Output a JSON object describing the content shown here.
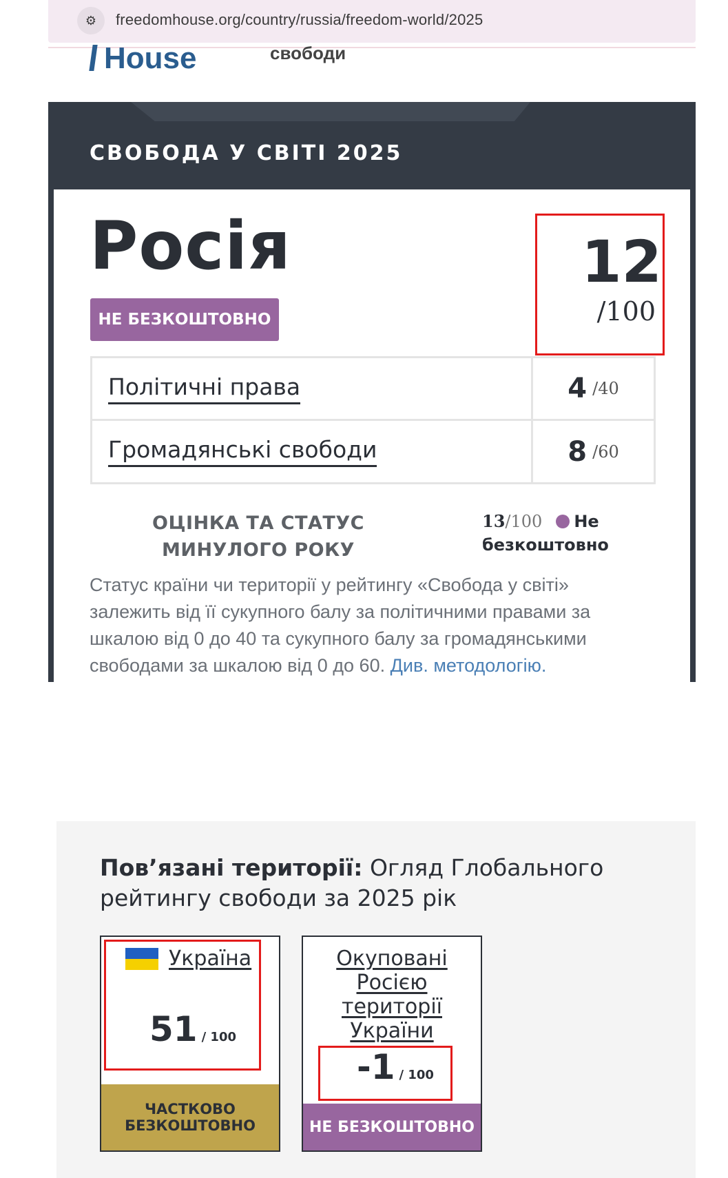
{
  "browser": {
    "url": "freedomhouse.org/country/russia/freedom-world/2025",
    "site_icon": "tune-icon"
  },
  "header": {
    "logo_text": "House",
    "fragment_text": "свободи"
  },
  "report": {
    "section_title": "СВОБОДА У СВІТІ 2025",
    "country": "Росія",
    "status": "НЕ БЕЗКОШТОВНО",
    "total_score": "12",
    "total_out_of": "/100",
    "subscores": [
      {
        "label": "Політичні права",
        "score": "4",
        "out_of": "/40"
      },
      {
        "label": "Громадянські свободи",
        "score": "8",
        "out_of": "/60"
      }
    ],
    "previous": {
      "label": "ОЦІНКА ТА СТАТУС МИНУЛОГО РОКУ",
      "score": "13",
      "out_of": "/100",
      "status": "Не безкоштовно"
    },
    "methodology_text": "Статус країни чи території у рейтингу «Свобода у світі» залежить від її сукупного балу за політичними правами за шкалою від 0 до 40 та сукупного балу за громадянськими свободами за шкалою від 0 до 60.",
    "methodology_link": "Див. методологію."
  },
  "related": {
    "title_bold": "Пов’язані території:",
    "title_rest": "Огляд Глобального рейтингу свободи за 2025 рік",
    "territories": [
      {
        "name": "Україна",
        "score": "51",
        "out_of": "/ 100",
        "status": "ЧАСТКОВО БЕЗКОШТОВНО",
        "flag_icon": "ukraine-flag-icon"
      },
      {
        "name": "Окуповані Росією території України",
        "score": "-1",
        "out_of": "/ 100",
        "status": "НЕ БЕЗКОШТОВНО"
      }
    ]
  },
  "colors": {
    "dark_panel": "#343b45",
    "not_free": "#98669f",
    "partly_free": "#bfa44c",
    "highlight": "#e31b1b",
    "link": "#4a7fb5"
  }
}
